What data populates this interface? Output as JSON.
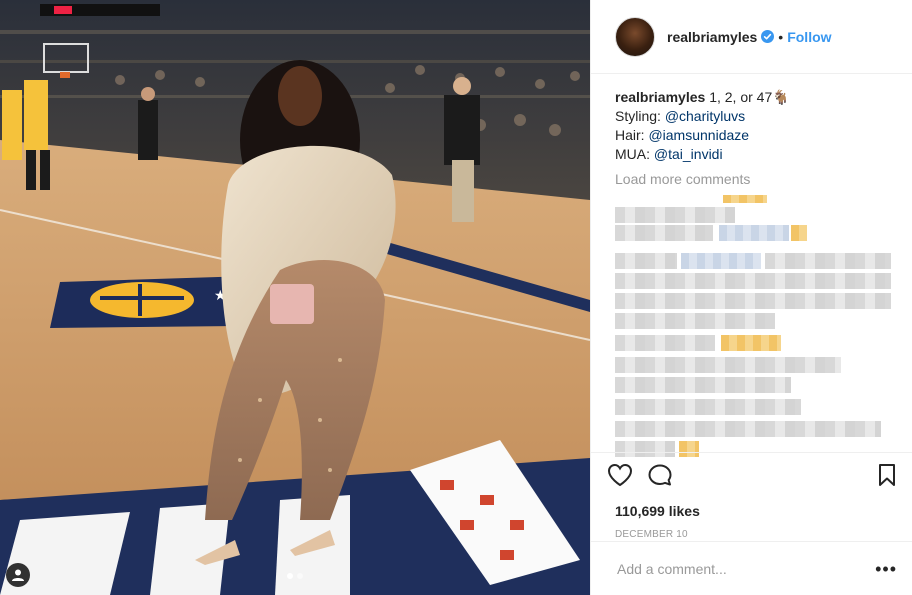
{
  "post": {
    "username": "realbriamyles",
    "verified": true,
    "separator": "•",
    "follow_label": "Follow",
    "caption": {
      "username": "realbriamyles",
      "line1_text": "1, 2, or 47",
      "line1_emoji": "🐐",
      "line2_text": "Styling: ",
      "line2_mention": "@charityluvs",
      "line3_text": "Hair: ",
      "line3_mention": "@iamsunnidaze",
      "line4_text": "MUA: ",
      "line4_mention": "@tai_invidi"
    },
    "load_more_label": "Load more comments",
    "likes": "110,699 likes",
    "date": "DECEMBER 10",
    "add_comment_placeholder": "Add a comment...",
    "more_options_label": "•••"
  },
  "icons": {
    "like": "heart-icon",
    "comment": "comment-bubble-icon",
    "save": "bookmark-icon",
    "verified": "verified-badge-icon",
    "tagged_user": "user-tag-icon",
    "more": "more-options-icon"
  },
  "colors": {
    "link_blue": "#3897f0",
    "mention_navy": "#003569",
    "muted_gray": "#999999",
    "text": "#262626"
  },
  "carousel": {
    "count": 2,
    "active_index": 0
  }
}
